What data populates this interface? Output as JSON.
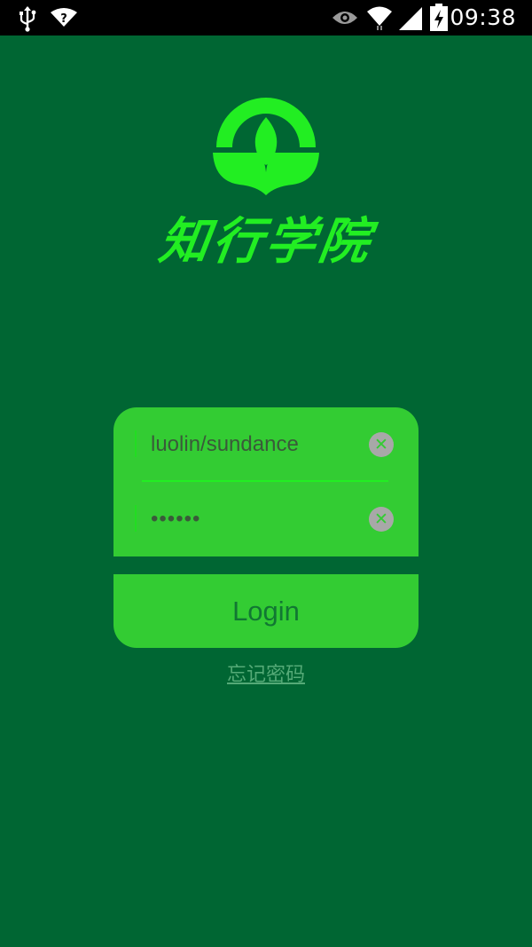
{
  "status_bar": {
    "time": "09:38",
    "icons": [
      "usb-icon",
      "wifi-question-icon",
      "eye-icon",
      "wifi-icon",
      "signal-icon",
      "battery-charging-icon"
    ]
  },
  "app": {
    "name": "知行学院",
    "logo_icon": "leaf-sprout-logo-icon",
    "accent_color": "#33cc33",
    "background_color": "#006633"
  },
  "login_form": {
    "username": {
      "value": "luolin/sundance",
      "clear_icon": "clear-icon"
    },
    "password": {
      "value": "••••••",
      "clear_icon": "clear-icon"
    },
    "login_label": "Login",
    "forgot_password_label": "忘记密码"
  }
}
